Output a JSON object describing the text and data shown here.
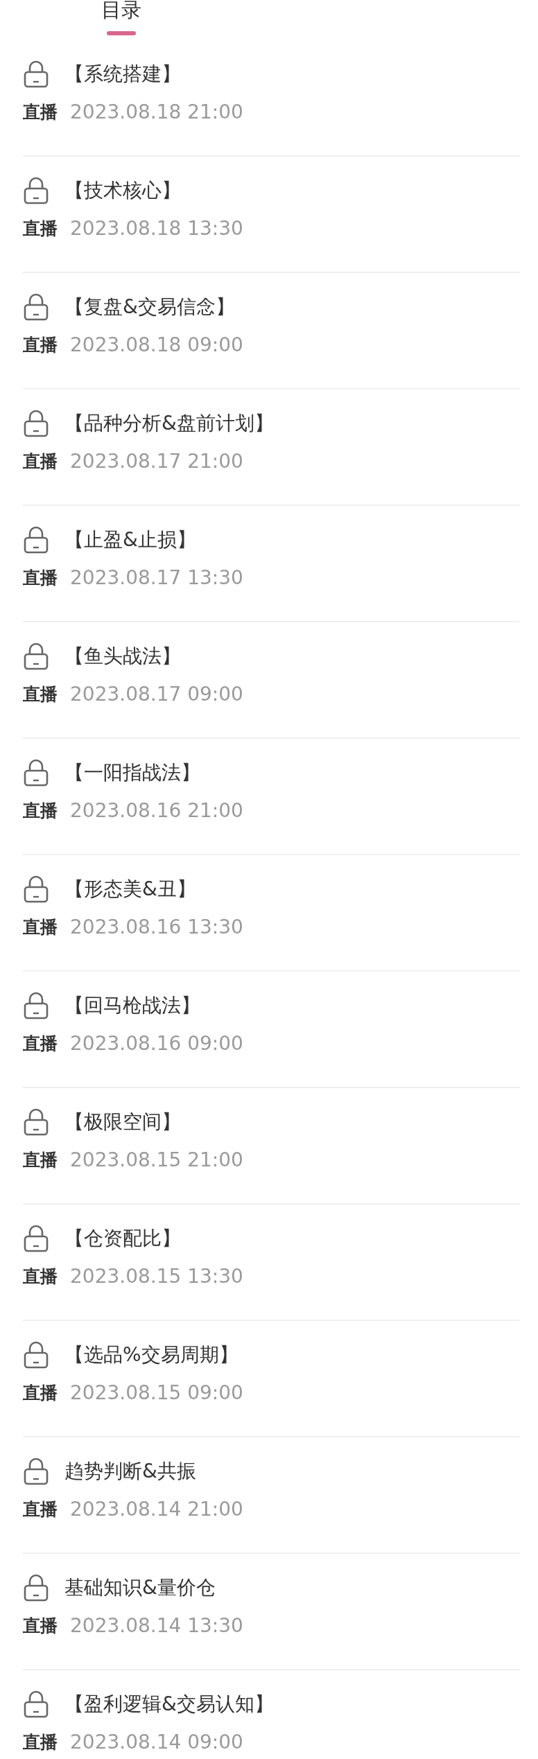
{
  "tabs": [
    {
      "label": "目录",
      "selected": true
    }
  ],
  "lessons": [
    {
      "title": "【系统搭建】",
      "type": "直播",
      "time": "2023.08.18 21:00",
      "locked": true
    },
    {
      "title": "【技术核心】",
      "type": "直播",
      "time": "2023.08.18 13:30",
      "locked": true
    },
    {
      "title": "【复盘&交易信念】",
      "type": "直播",
      "time": "2023.08.18 09:00",
      "locked": true
    },
    {
      "title": "【品种分析&盘前计划】",
      "type": "直播",
      "time": "2023.08.17 21:00",
      "locked": true
    },
    {
      "title": "【止盈&止损】",
      "type": "直播",
      "time": "2023.08.17 13:30",
      "locked": true
    },
    {
      "title": "【鱼头战法】",
      "type": "直播",
      "time": "2023.08.17 09:00",
      "locked": true
    },
    {
      "title": "【一阳指战法】",
      "type": "直播",
      "time": "2023.08.16 21:00",
      "locked": true
    },
    {
      "title": "【形态美&丑】",
      "type": "直播",
      "time": "2023.08.16 13:30",
      "locked": true
    },
    {
      "title": "【回马枪战法】",
      "type": "直播",
      "time": "2023.08.16 09:00",
      "locked": true
    },
    {
      "title": "【极限空间】",
      "type": "直播",
      "time": "2023.08.15 21:00",
      "locked": true
    },
    {
      "title": "【仓资配比】",
      "type": "直播",
      "time": "2023.08.15 13:30",
      "locked": true
    },
    {
      "title": "【选品%交易周期】",
      "type": "直播",
      "time": "2023.08.15 09:00",
      "locked": true
    },
    {
      "title": "趋势判断&共振",
      "type": "直播",
      "time": "2023.08.14 21:00",
      "locked": true
    },
    {
      "title": "基础知识&量价仓",
      "type": "直播",
      "time": "2023.08.14 13:30",
      "locked": true
    },
    {
      "title": "【盈利逻辑&交易认知】",
      "type": "直播",
      "time": "2023.08.14 09:00",
      "locked": true
    }
  ]
}
